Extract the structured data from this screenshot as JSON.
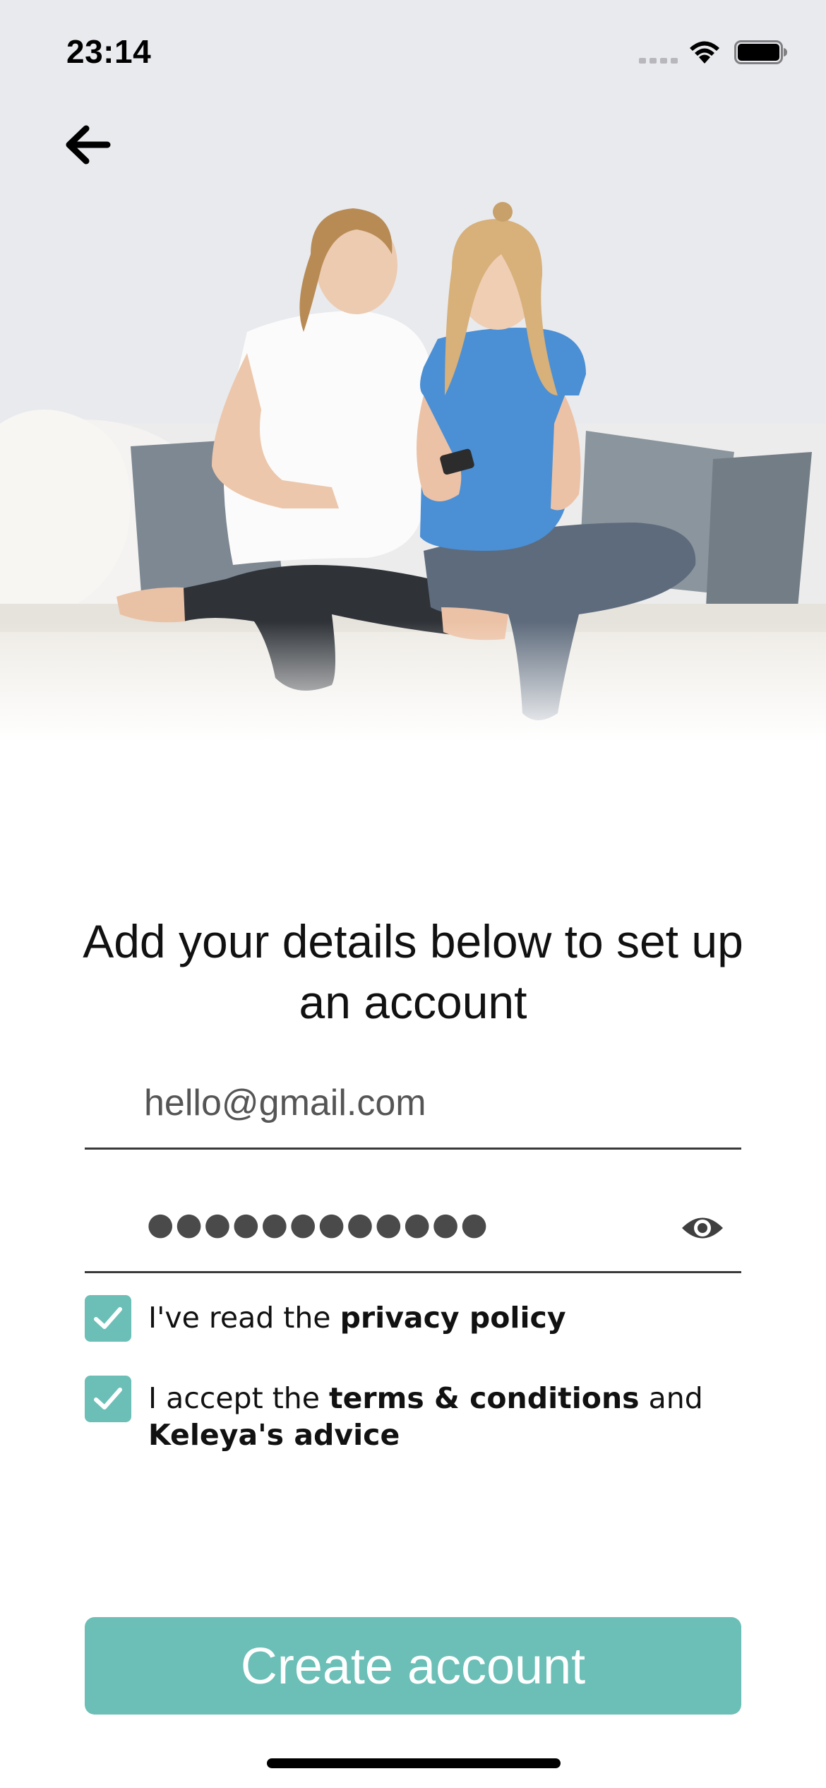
{
  "status_bar": {
    "time": "23:14",
    "signal_icon": "cellular-signal-icon",
    "wifi_icon": "wifi-icon",
    "battery_icon": "battery-icon"
  },
  "navigation": {
    "back_icon": "arrow-left-icon"
  },
  "hero": {
    "image": "two-pregnant-women-on-sofa-photo"
  },
  "form": {
    "heading": "Add your details below to set up an account",
    "email": {
      "value": "hello@gmail.com",
      "placeholder": ""
    },
    "password": {
      "masked_value": "●●●●●●●●●●●●",
      "visibility_icon": "eye-icon"
    },
    "privacy": {
      "checked": true,
      "prefix": "I've read the ",
      "link": "privacy policy"
    },
    "terms": {
      "checked": true,
      "prefix": "I accept the ",
      "link": "terms & conditions",
      "middle": " and ",
      "advice_link": "Keleya's advice"
    }
  },
  "actions": {
    "create_account_label": "Create account"
  },
  "colors": {
    "accent": "#6bbfb7",
    "text": "#111111",
    "divider": "#3a3a3a"
  }
}
